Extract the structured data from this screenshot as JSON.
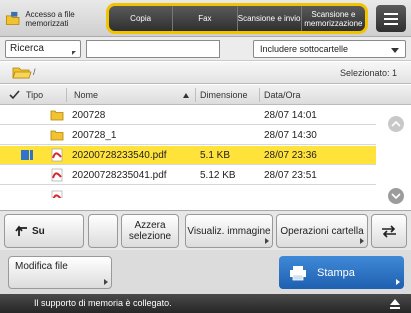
{
  "toolbar": {
    "memory_access_label": "Accesso a file memorizzati",
    "copy_label": "Copia",
    "fax_label": "Fax",
    "scan_send_label": "Scansione e invio",
    "scan_store_label": "Scansione e memorizzazione"
  },
  "search": {
    "mode_label": "Ricerca",
    "input_value": "",
    "subfolders_label": "Includere sottocartelle"
  },
  "path": {
    "text": "/",
    "selected_count": "Selezionato: 1"
  },
  "table": {
    "headers": {
      "type": "Tipo",
      "name": "Nome",
      "size": "Dimensione",
      "date": "Data/Ora"
    },
    "rows": [
      {
        "name": "200728",
        "size": "",
        "date": "28/07  14:01",
        "kind": "folder",
        "selected": false
      },
      {
        "name": "200728_1",
        "size": "",
        "date": "28/07  14:30",
        "kind": "folder",
        "selected": false
      },
      {
        "name": "20200728233540.pdf",
        "size": "5.1 KB",
        "date": "28/07  23:36",
        "kind": "pdf",
        "selected": true
      },
      {
        "name": "20200728235041.pdf",
        "size": "5.12 KB",
        "date": "28/07  23:51",
        "kind": "pdf",
        "selected": false
      }
    ]
  },
  "buttons": {
    "up_label": "Su",
    "clear_selection_label": "Azzera selezione",
    "view_image_label": "Visualiz. immagine",
    "folder_ops_label": "Operazioni cartella",
    "edit_file_label": "Modifica file",
    "print_label": "Stampa"
  },
  "status": {
    "message": "Il supporto di memoria è collegato."
  },
  "colors": {
    "accent_yellow": "#f2c300",
    "selection_yellow": "#ffe33a",
    "print_blue": "#2f74c8",
    "pdf_red": "#d8262c",
    "folder_yellow": "#f1c232"
  }
}
